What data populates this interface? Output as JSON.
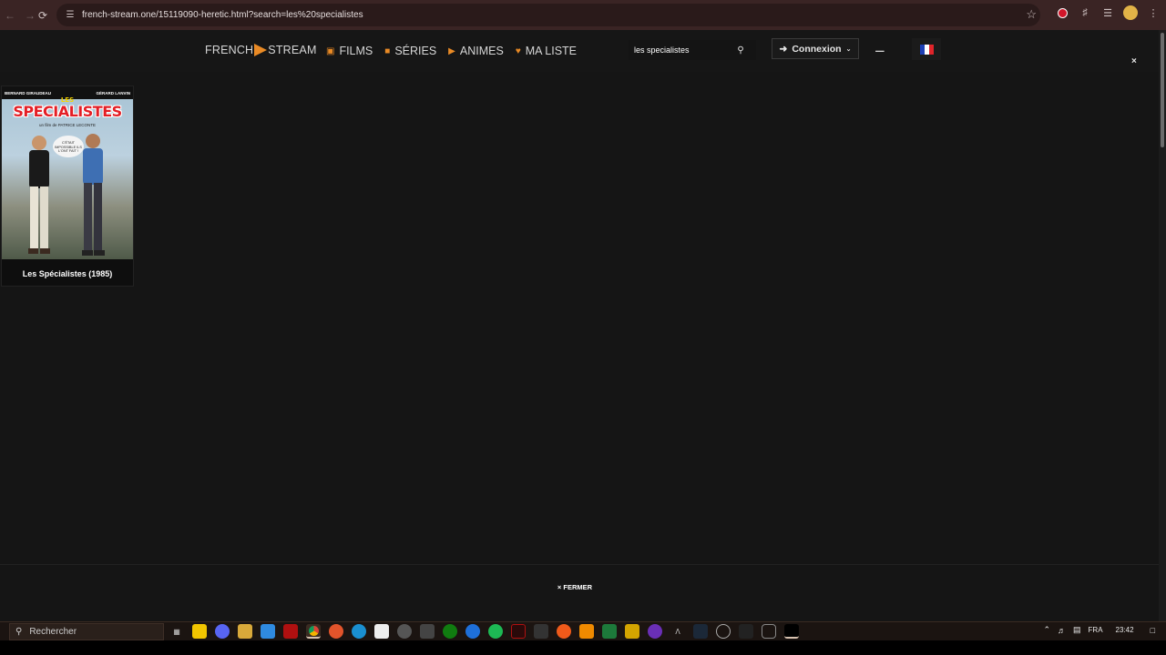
{
  "browser": {
    "url": "french-stream.one/15119090-heretic.html?search=les%20specialistes",
    "back_icon": "back-arrow-icon",
    "forward_icon": "forward-arrow-icon",
    "reload_icon": "reload-icon"
  },
  "site": {
    "logo_left": "FRENCH",
    "logo_right": "STREAM",
    "nav": [
      {
        "label": "FILMS",
        "icon": "film-icon"
      },
      {
        "label": "SÉRIES",
        "icon": "camera-icon"
      },
      {
        "label": "ANIMES",
        "icon": "play-circle-icon"
      },
      {
        "label": "MA LISTE",
        "icon": "heart-icon"
      }
    ],
    "search_value": "les specialistes",
    "login_label": "Connexion",
    "close_label": "×"
  },
  "result": {
    "title": "Les Spécialistes (1985)",
    "poster": {
      "actor_left": "BERNARD GIRAUDEAU",
      "actor_right": "GÉRARD LANVIN",
      "les": "LES",
      "title": "SPECIALISTES",
      "director": "un film de PATRICE LECONTE",
      "bubble": "C'ÉTAIT IMPOSSIBLE ILS L'ONT FAIT !"
    }
  },
  "footer": {
    "close_label": "× FERMER"
  },
  "taskbar": {
    "search_placeholder": "Rechercher",
    "lang": "FRA",
    "time": "23:42"
  },
  "colors": {
    "accent": "#e98a25",
    "page_bg": "#151515",
    "browser_bar": "#3a2424"
  }
}
